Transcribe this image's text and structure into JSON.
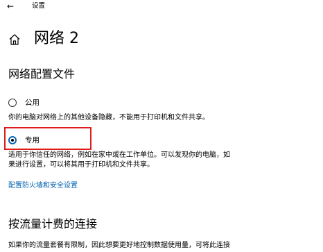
{
  "window": {
    "back_glyph": "←",
    "title": "设置"
  },
  "header": {
    "icon": "home-icon",
    "title": "网络 2"
  },
  "network_profile": {
    "heading": "网络配置文件",
    "options": [
      {
        "label": "公用",
        "checked": false,
        "description": [
          "你的电脑对网络上的其他设备隐藏，不能用于打印机和文件共享。"
        ]
      },
      {
        "label": "专用",
        "checked": true,
        "description": [
          "适用于你信任的网络，例如在家中或在工作单位。可以发现你的电脑，如",
          "果进行设置，可以将其用于打印机和文件共享。"
        ]
      }
    ],
    "firewall_link": "配置防火墙和安全设置"
  },
  "metered": {
    "heading": "按流量计费的连接",
    "description": "如果你的流量套餐有限制，因此想要更好地控制数据使用量，可将此连接"
  },
  "colors": {
    "accent": "#0063b1",
    "highlight": "#e01b1b"
  }
}
